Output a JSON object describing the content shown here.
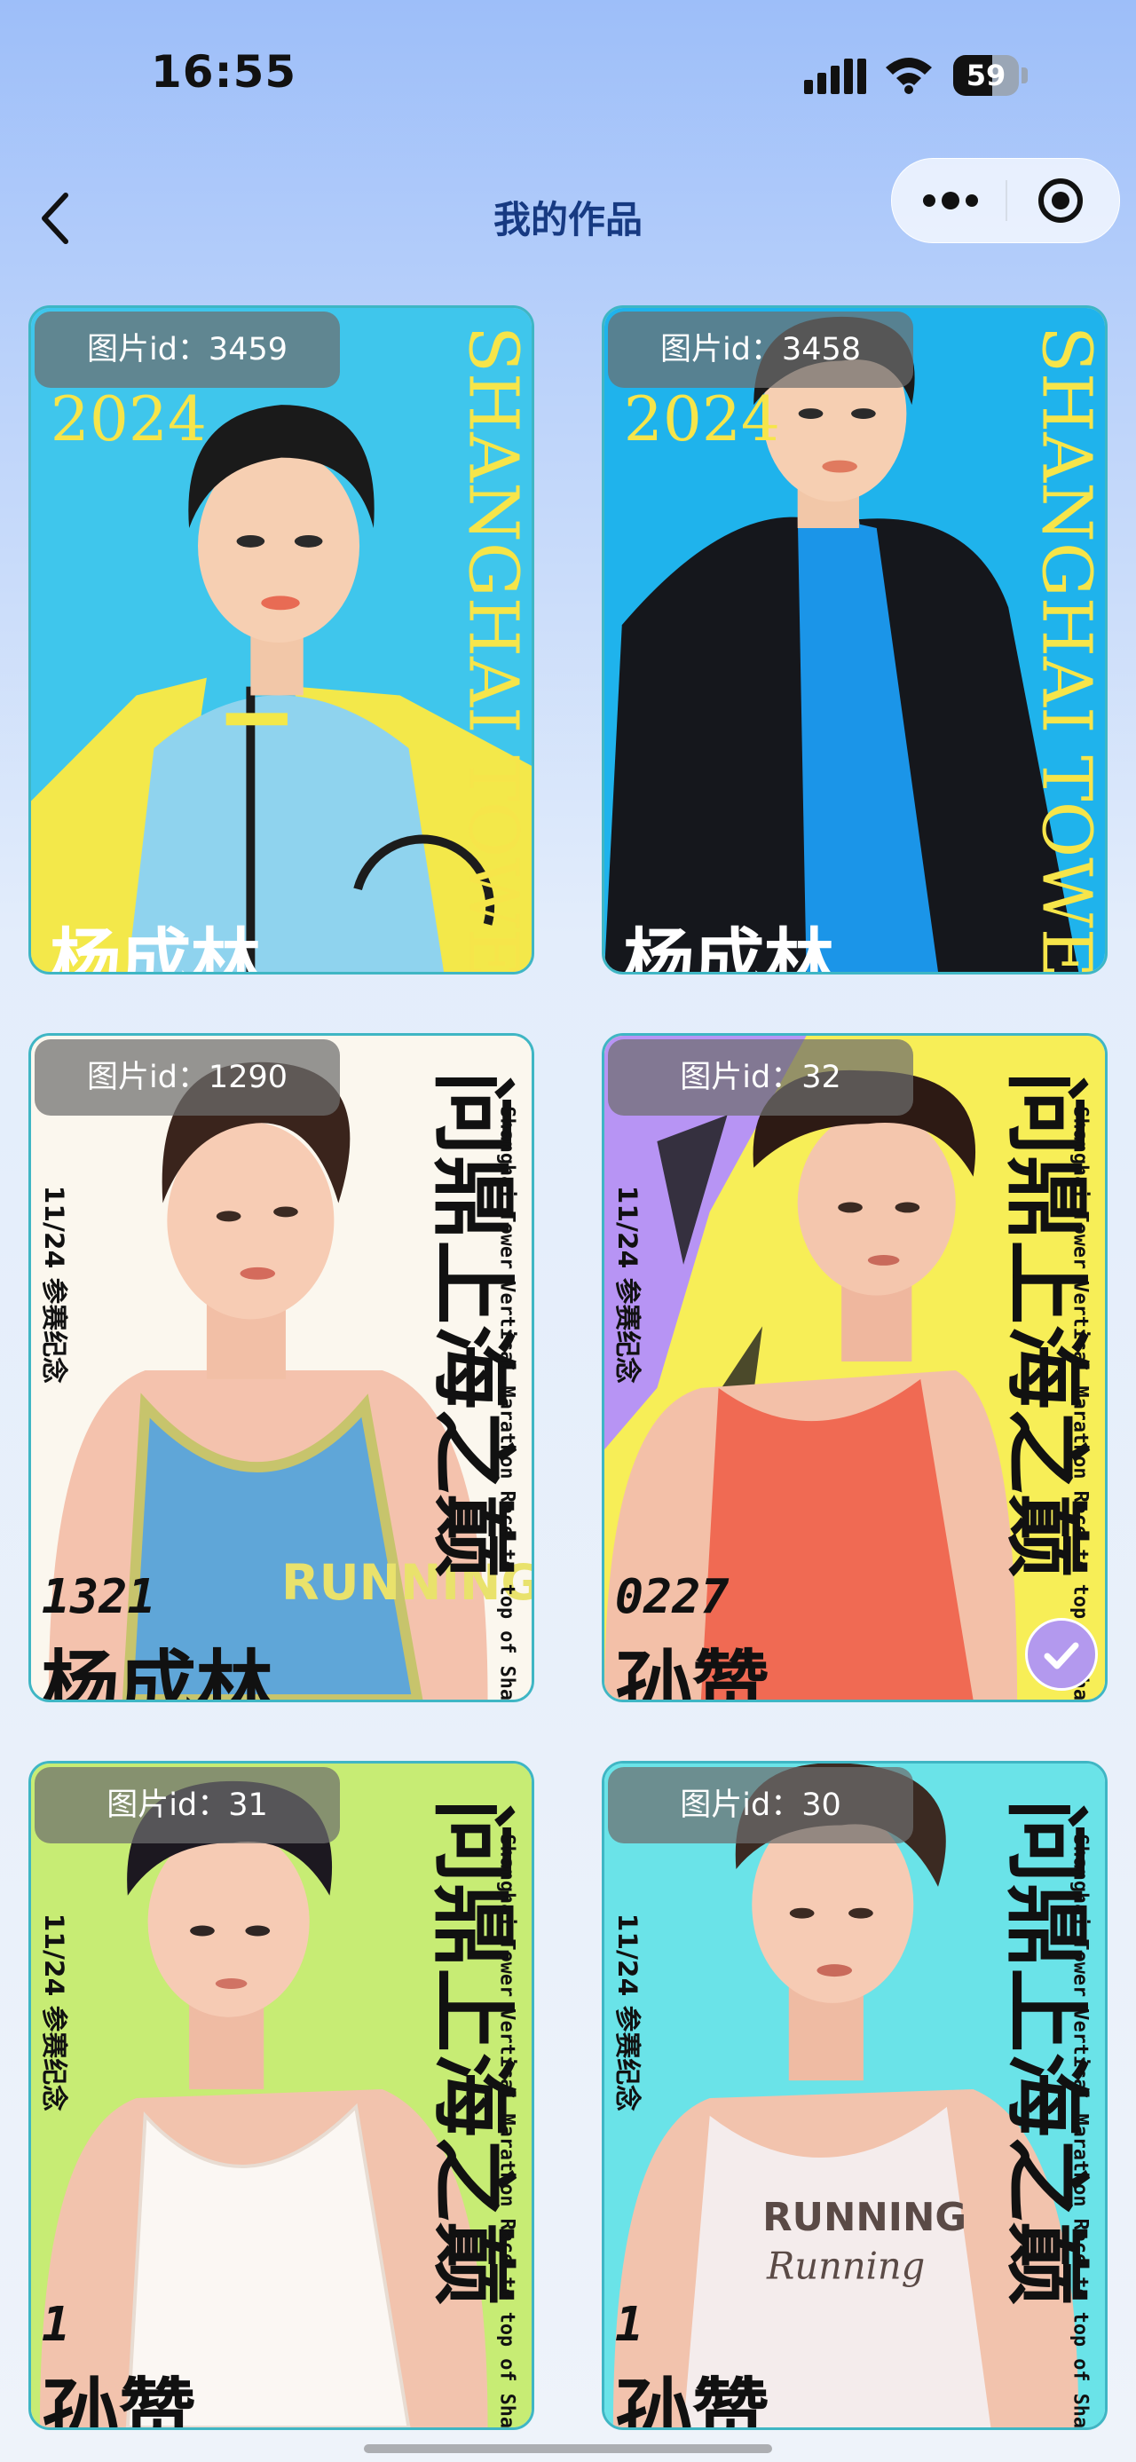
{
  "status_bar": {
    "time": "16:55",
    "battery_level": "59",
    "battery_fraction": 0.59
  },
  "nav": {
    "title": "我的作品",
    "back_icon": "chevron-left-icon",
    "more_icon": "more-dots-icon",
    "record_icon": "target-circle-icon"
  },
  "colors": {
    "title": "#173a82",
    "card_border": "#3fb6c4",
    "check_badge": "#b399ee"
  },
  "cards": [
    {
      "id_label": "图片id：3459",
      "selected": false,
      "poster": {
        "year": "2024",
        "brand": "SHANGHAI TOWER",
        "name": "杨成林"
      }
    },
    {
      "id_label": "图片id：3458",
      "selected": false,
      "poster": {
        "year": "2024",
        "brand": "SHANGHAI TOWER",
        "name": "杨成林"
      }
    },
    {
      "id_label": "图片id：1290",
      "selected": false,
      "poster": {
        "headline": "问鼎上海之巅",
        "date": "11/24 参赛纪念",
        "side": "Shanghai Tower Vertical Marathon Race to top of Shanghai",
        "number": "1321",
        "name": "杨成林",
        "shirt": "RUNNING"
      }
    },
    {
      "id_label": "图片id：32",
      "selected": true,
      "poster": {
        "headline": "问鼎上海之巅",
        "date": "11/24 参赛纪念",
        "side": "Shanghai Tower Vertical Marathon Race to top of Shanghai",
        "number": "0227",
        "name": "孙赞"
      }
    },
    {
      "id_label": "图片id：31",
      "selected": false,
      "poster": {
        "headline": "问鼎上海之巅",
        "date": "11/24 参赛纪念",
        "side": "Shanghai Tower Vertical Marathon Race to top of Shanghai",
        "number": "1",
        "name": "孙赞"
      }
    },
    {
      "id_label": "图片id：30",
      "selected": false,
      "poster": {
        "headline": "问鼎上海之巅",
        "date": "11/24 参赛纪念",
        "side": "Shanghai Tower Vertical Marathon Race to top of Shanghai",
        "number": "1",
        "name": "孙赞",
        "shirt": "RUNNING",
        "shirt_script": "Running"
      }
    }
  ]
}
